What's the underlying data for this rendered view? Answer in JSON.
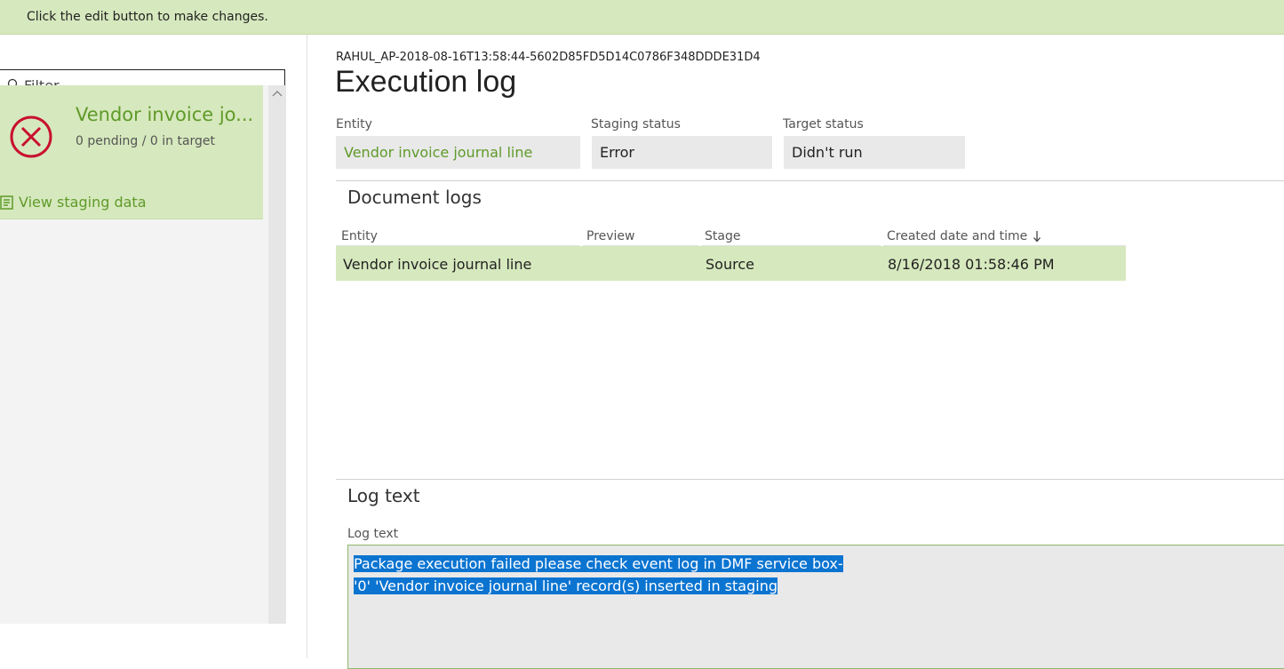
{
  "banner": {
    "message": "Click the edit button to make changes."
  },
  "sidebar": {
    "filter_placeholder": "Filter",
    "card": {
      "title": "Vendor invoice jo...",
      "subtitle": "0 pending / 0 in target",
      "link_label": "View staging data",
      "status_icon": "error-circle-x-icon",
      "status_color": "#c8102e"
    }
  },
  "main": {
    "run_id": "RAHUL_AP-2018-08-16T13:58:44-5602D85FD5D14C0786F348DDDE31D4",
    "title": "Execution log",
    "fields": {
      "entity_label": "Entity",
      "entity_value": "Vendor invoice journal line",
      "staging_label": "Staging status",
      "staging_value": "Error",
      "target_label": "Target status",
      "target_value": "Didn't run"
    },
    "document_logs": {
      "title": "Document logs",
      "columns": [
        "Entity",
        "Preview",
        "Stage",
        "Created date and time"
      ],
      "sort_icon": "arrow-down-icon",
      "rows": [
        {
          "entity": "Vendor invoice journal line",
          "preview": "",
          "stage": "Source",
          "created": "8/16/2018 01:58:46 PM"
        }
      ]
    },
    "log_text": {
      "title": "Log text",
      "label": "Log text",
      "lines": [
        "Package execution failed please check event log in DMF service box-",
        "'0' 'Vendor invoice journal line' record(s) inserted in staging"
      ]
    }
  },
  "colors": {
    "accent_green": "#5f9a2a",
    "selection_bg": "#d6e8bd",
    "text_selection": "#0b74d1"
  }
}
